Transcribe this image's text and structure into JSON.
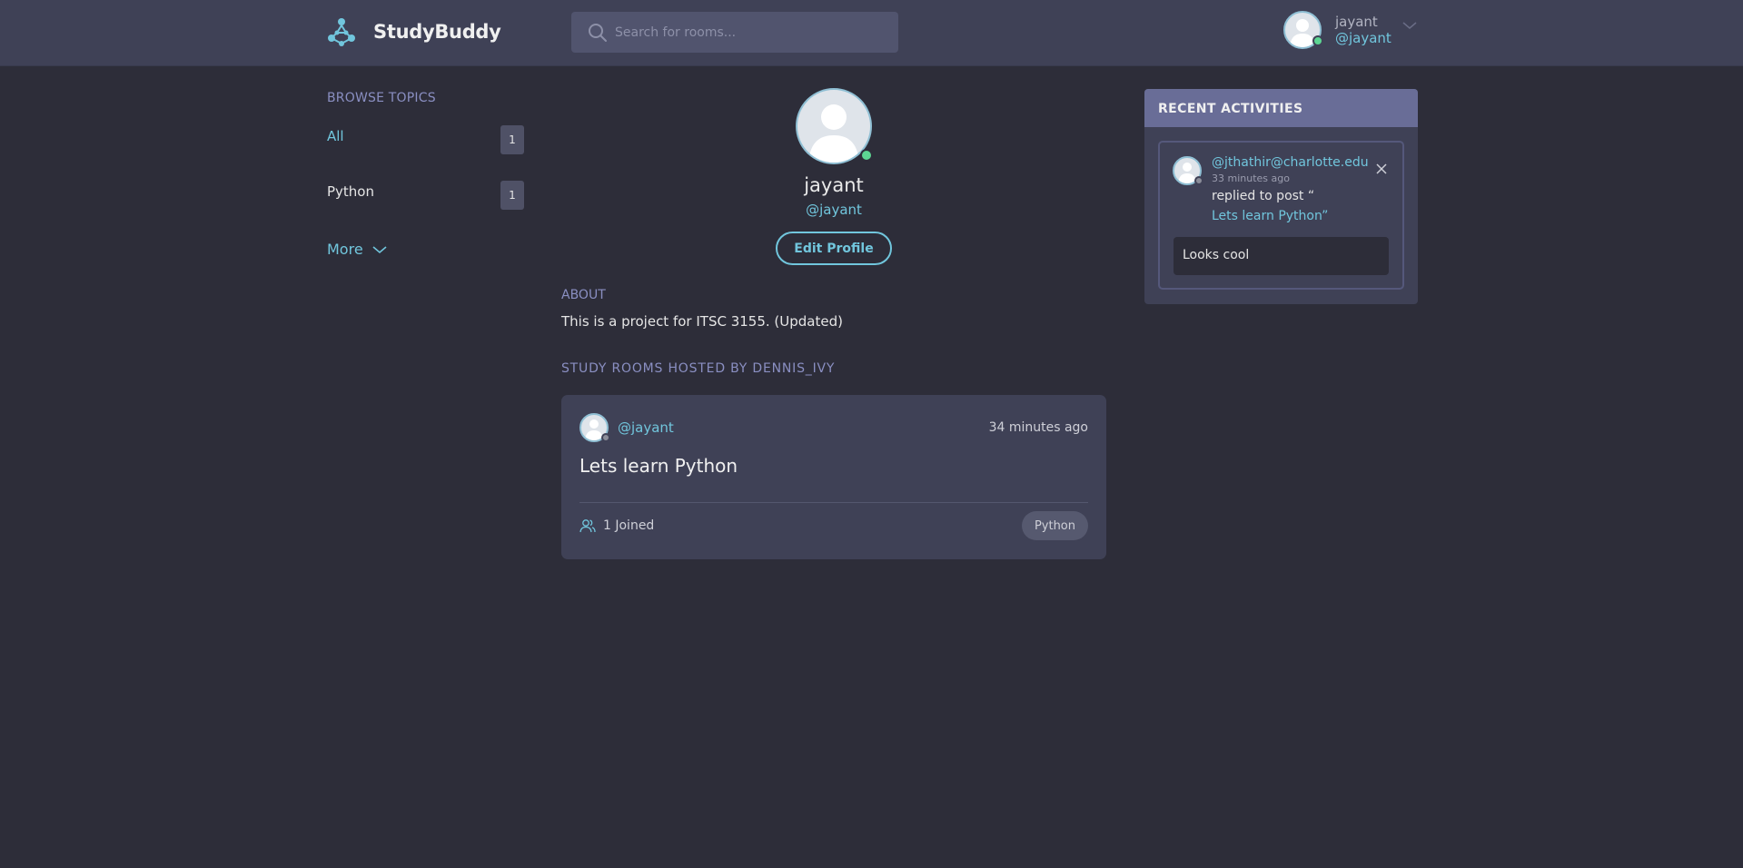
{
  "header": {
    "brand": "StudyBuddy",
    "search_placeholder": "Search for rooms...",
    "user": {
      "name": "jayant",
      "handle": "@jayant",
      "status": "online"
    }
  },
  "sidebar": {
    "title": "Browse Topics",
    "topics": [
      {
        "label": "All",
        "count": "1",
        "active": true
      },
      {
        "label": "Python",
        "count": "1",
        "active": false
      }
    ],
    "more_label": "More"
  },
  "profile": {
    "name": "jayant",
    "handle": "@jayant",
    "edit_label": "Edit Profile",
    "about_title": "About",
    "about_text": "This is a project for ITSC 3155. (Updated)",
    "rooms_title": "Study Rooms Hosted by dennis_ivy"
  },
  "rooms": [
    {
      "host": "@jayant",
      "time": "34 minutes ago",
      "title": "Lets learn Python",
      "joined": "1 Joined",
      "topic": "Python"
    }
  ],
  "activity": {
    "title": "Recent Activities",
    "items": [
      {
        "user": "@jthathir@charlotte.edu",
        "time": "33 minutes ago",
        "action": "replied to post “",
        "link": "Lets learn Python”",
        "reply": "Looks cool"
      }
    ]
  },
  "colors": {
    "background": "#2d2d39",
    "surface": "#3f4156",
    "accent": "#71c6dd",
    "heading": "#8a8fc2",
    "activity_header": "#696d97",
    "online": "#5dd693"
  },
  "icons": {
    "logo": "studybuddy-logo-icon",
    "search": "search-icon",
    "dropdown": "chevron-down-icon",
    "people": "people-icon",
    "close": "close-icon"
  }
}
